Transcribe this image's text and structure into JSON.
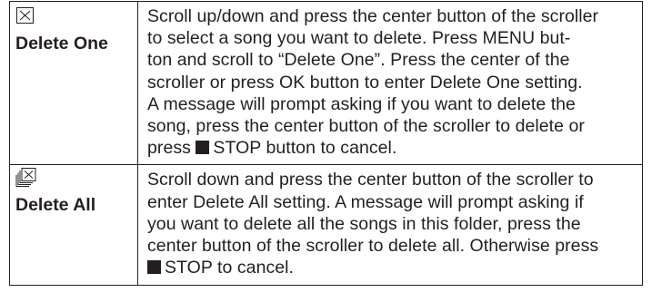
{
  "rows": [
    {
      "id": "delete-one",
      "icon": "delete-one-icon",
      "label": "Delete One",
      "lines": [
        "Scroll up/down and press the center button of the scroller",
        "to select a song you want to delete. Press MENU but-",
        "ton and scroll to “Delete One”. Press the center of the",
        "scroller or press OK button to enter Delete One setting.",
        "A message will prompt asking if you want to delete the",
        "song, press the center button of the  scroller to delete or"
      ],
      "stop_prefix": "press",
      "stop_icon": "stop-square-icon",
      "stop_text": "STOP button to cancel."
    },
    {
      "id": "delete-all",
      "icon": "delete-all-icon",
      "label": "Delete All",
      "lines": [
        "Scroll down and press the center button of the scroller to",
        "enter Delete All setting. A message will prompt asking if",
        "you want to delete all the songs in this folder, press the",
        "center button of the scroller to delete all. Otherwise press"
      ],
      "stop_prefix": "",
      "stop_icon": "stop-square-icon",
      "stop_text": "STOP to cancel."
    }
  ]
}
